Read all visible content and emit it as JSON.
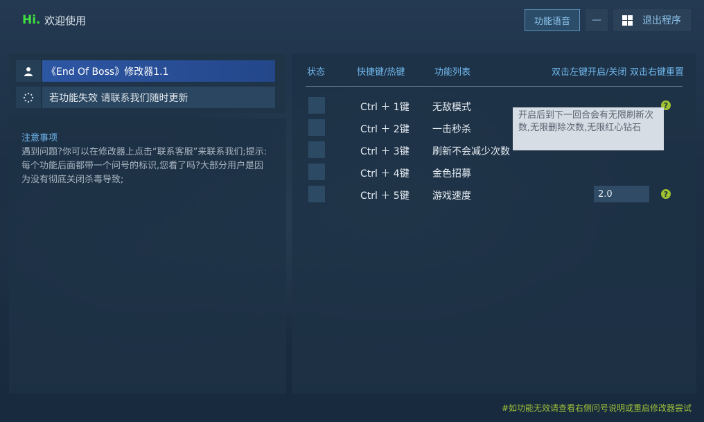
{
  "header": {
    "hi": "Hi.",
    "welcome": "欢迎使用",
    "voice_button": "功能语音",
    "minimize_button": "—",
    "exit_button": "退出程序"
  },
  "left": {
    "game_title": "《End Of Boss》修改器1.1",
    "info_line": "若功能失效 请联系我们随时更新",
    "notes_title": "注意事项",
    "notes_body": "遇到问题?你可以在修改器上点击“联系客服”来联系我们;提示:每个功能后面都带一个问号的标识,您看了吗?大部分用户是因为没有彻底关闭杀毒导致;"
  },
  "table": {
    "headers": {
      "status": "状态",
      "hotkey": "快捷键/热键",
      "features": "功能列表",
      "toggle_hint": "双击左键开启/关闭",
      "reset_hint": "双击右键重置"
    },
    "rows": [
      {
        "hotkey": "Ctrl ＋ 1键",
        "feature": "无敌模式"
      },
      {
        "hotkey": "Ctrl ＋ 2键",
        "feature": "一击秒杀"
      },
      {
        "hotkey": "Ctrl ＋ 3键",
        "feature": "刷新不会减少次数"
      },
      {
        "hotkey": "Ctrl ＋ 4键",
        "feature": "金色招募"
      },
      {
        "hotkey": "Ctrl ＋ 5键",
        "feature": "游戏速度"
      }
    ],
    "speed_value": "2.0",
    "help_glyph": "?"
  },
  "tooltip": "开启后到下一回合会有无限刷新次数,无限删除次数,无限红心钻石",
  "footer": "#如功能无效请查看右侧问号说明或重启修改器尝试",
  "colors": {
    "accent_green": "#3fe03f",
    "accent_blue": "#6fb7ec",
    "help_icon": "#9fc330",
    "selected_row": "#2d56a3"
  }
}
